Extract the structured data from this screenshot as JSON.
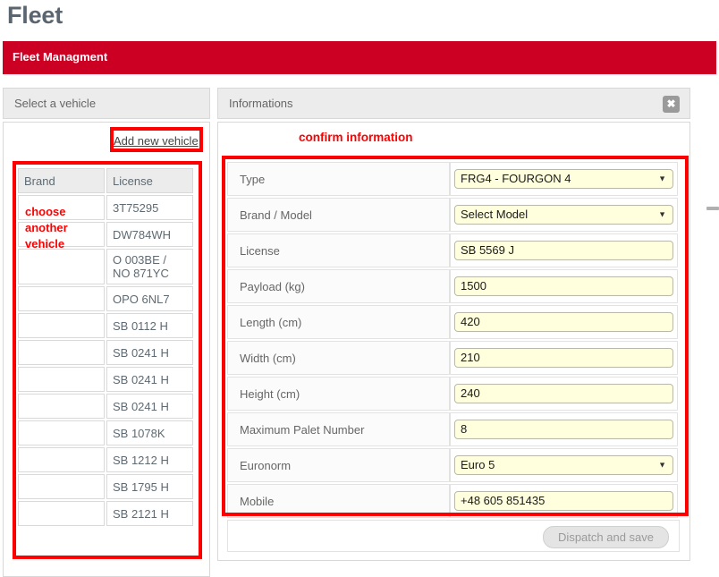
{
  "page": {
    "title": "Fleet"
  },
  "module_bar": {
    "label": "Fleet Managment",
    "color": "#cc0022"
  },
  "left_panel": {
    "header": "Select a vehicle",
    "add_link": "Add new vehicle",
    "table": {
      "columns": [
        "Brand",
        "License"
      ],
      "rows": [
        {
          "brand": "",
          "license": "3T75295"
        },
        {
          "brand": "",
          "license": "DW784WH"
        },
        {
          "brand": "",
          "license": "O 003BE / NO 871YC"
        },
        {
          "brand": "",
          "license": "OPO 6NL7"
        },
        {
          "brand": "",
          "license": "SB 0112 H"
        },
        {
          "brand": "",
          "license": "SB 0241 H"
        },
        {
          "brand": "",
          "license": "SB 0241 H"
        },
        {
          "brand": "",
          "license": "SB 0241 H"
        },
        {
          "brand": "",
          "license": "SB 1078K"
        },
        {
          "brand": "",
          "license": "SB 1212 H"
        },
        {
          "brand": "",
          "license": "SB 1795 H"
        },
        {
          "brand": "",
          "license": "SB 2121 H"
        }
      ]
    }
  },
  "right_panel": {
    "header": "Informations",
    "close_icon": "close-icon",
    "close_glyph": "✖",
    "fields": [
      {
        "label": "Type",
        "value": "FRG4 - FOURGON 4",
        "kind": "select"
      },
      {
        "label": "Brand / Model",
        "value": "Select Model",
        "kind": "select"
      },
      {
        "label": "License",
        "value": "SB 5569 J",
        "kind": "text"
      },
      {
        "label": "Payload (kg)",
        "value": "1500",
        "kind": "text"
      },
      {
        "label": "Length (cm)",
        "value": "420",
        "kind": "text"
      },
      {
        "label": "Width (cm)",
        "value": "210",
        "kind": "text"
      },
      {
        "label": "Height (cm)",
        "value": "240",
        "kind": "text"
      },
      {
        "label": "Maximum Palet Number",
        "value": "8",
        "kind": "text"
      },
      {
        "label": "Euronorm",
        "value": "Euro 5",
        "kind": "select"
      },
      {
        "label": "Mobile",
        "value": "+48 605 851435",
        "kind": "text"
      }
    ],
    "dispatch_button": "Dispatch and save"
  },
  "annotations": {
    "color": "#ff0000",
    "confirm_information": "confirm information",
    "choose_another_vehicle": "choose another vehicle"
  }
}
